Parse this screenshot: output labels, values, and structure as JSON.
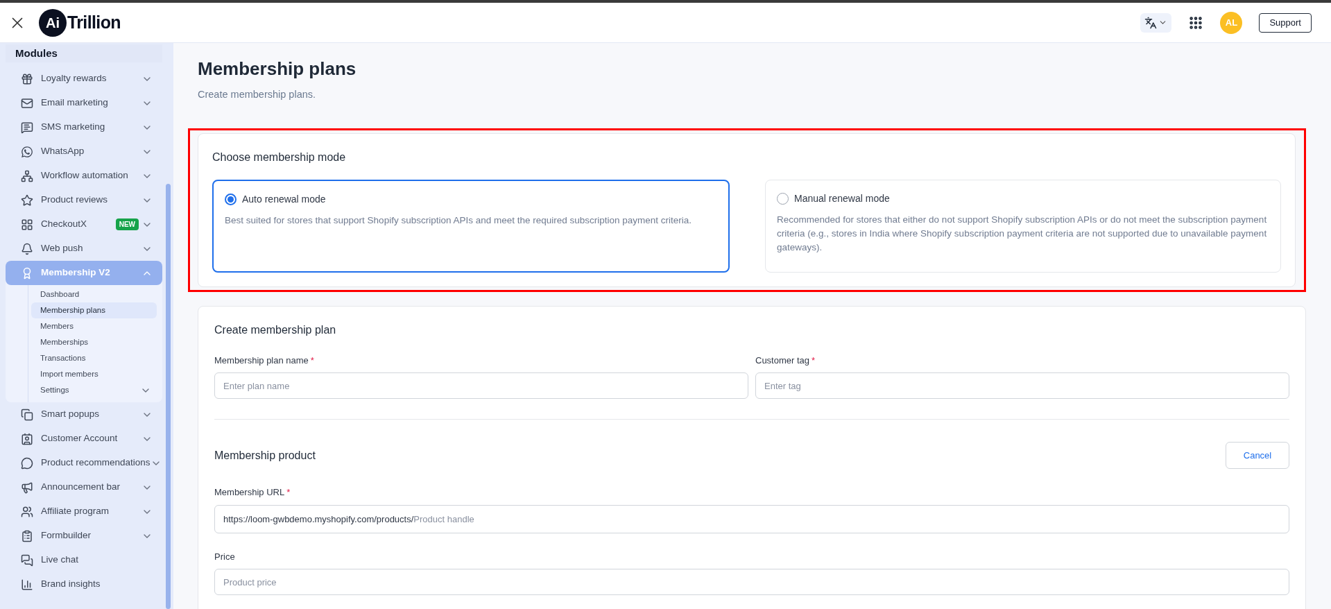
{
  "header": {
    "logo": {
      "badge": "Ai",
      "text": "Trillion"
    },
    "avatar": "AL",
    "support": "Support"
  },
  "sidebar": {
    "section": "Modules",
    "items": [
      {
        "label": "Loyalty rewards",
        "kind": "group",
        "expanded": false,
        "selected": false
      },
      {
        "label": "Email marketing",
        "kind": "group",
        "expanded": false,
        "selected": false
      },
      {
        "label": "SMS marketing",
        "kind": "group",
        "expanded": false,
        "selected": false
      },
      {
        "label": "WhatsApp",
        "kind": "group",
        "expanded": false,
        "selected": false
      },
      {
        "label": "Workflow automation",
        "kind": "group",
        "expanded": false,
        "selected": false
      },
      {
        "label": "Product reviews",
        "kind": "group",
        "expanded": false,
        "selected": false
      },
      {
        "label": "CheckoutX",
        "kind": "group",
        "badge": "NEW",
        "expanded": false,
        "selected": false
      },
      {
        "label": "Web push",
        "kind": "group",
        "expanded": false,
        "selected": false
      },
      {
        "label": "Membership V2",
        "kind": "group",
        "expanded": true,
        "selected": true,
        "children": [
          {
            "label": "Dashboard",
            "kind": "link",
            "selected": false
          },
          {
            "label": "Membership plans",
            "kind": "link",
            "selected": true
          },
          {
            "label": "Members",
            "kind": "link",
            "selected": false
          },
          {
            "label": "Memberships",
            "kind": "link",
            "selected": false
          },
          {
            "label": "Transactions",
            "kind": "link",
            "selected": false
          },
          {
            "label": "Import members",
            "kind": "link",
            "selected": false
          },
          {
            "label": "Settings",
            "kind": "group",
            "selected": false
          }
        ]
      },
      {
        "label": "Smart popups",
        "kind": "group",
        "expanded": false,
        "selected": false
      },
      {
        "label": "Customer Account",
        "kind": "group",
        "expanded": false,
        "selected": false
      },
      {
        "label": "Product recommendations",
        "kind": "group",
        "expanded": false,
        "selected": false
      },
      {
        "label": "Announcement bar",
        "kind": "group",
        "expanded": false,
        "selected": false
      },
      {
        "label": "Affiliate program",
        "kind": "group",
        "expanded": false,
        "selected": false
      },
      {
        "label": "Formbuilder",
        "kind": "group",
        "expanded": false,
        "selected": false
      },
      {
        "label": "Live chat",
        "kind": "link",
        "selected": false
      },
      {
        "label": "Brand insights",
        "kind": "link",
        "selected": false
      }
    ]
  },
  "page": {
    "title": "Membership plans",
    "subtitle": "Create membership plans."
  },
  "mode_card": {
    "title": "Choose membership mode",
    "options": [
      {
        "label": "Auto renewal mode",
        "description": "Best suited for stores that support Shopify subscription APIs and meet the required subscription payment criteria.",
        "selected": true
      },
      {
        "label": "Manual renewal mode",
        "description": "Recommended for stores that either do not support Shopify subscription APIs or do not meet the subscription payment criteria (e.g., stores in India where Shopify subscription payment criteria are not supported due to unavailable payment gateways).",
        "selected": false
      }
    ]
  },
  "plan_card": {
    "title": "Create membership plan",
    "fields": [
      {
        "label": "Membership plan name",
        "required_mark": "*",
        "placeholder": "Enter plan name"
      },
      {
        "label": "Customer tag",
        "required_mark": "*",
        "placeholder": "Enter tag"
      }
    ],
    "product": {
      "title": "Membership product",
      "cancel": "Cancel",
      "url": {
        "label": "Membership URL",
        "required_mark": "*",
        "prefix": "https://loom-gwbdemo.myshopify.com/products/",
        "placeholder": "Product handle"
      },
      "price": {
        "label": "Price",
        "placeholder": "Product price"
      }
    }
  }
}
